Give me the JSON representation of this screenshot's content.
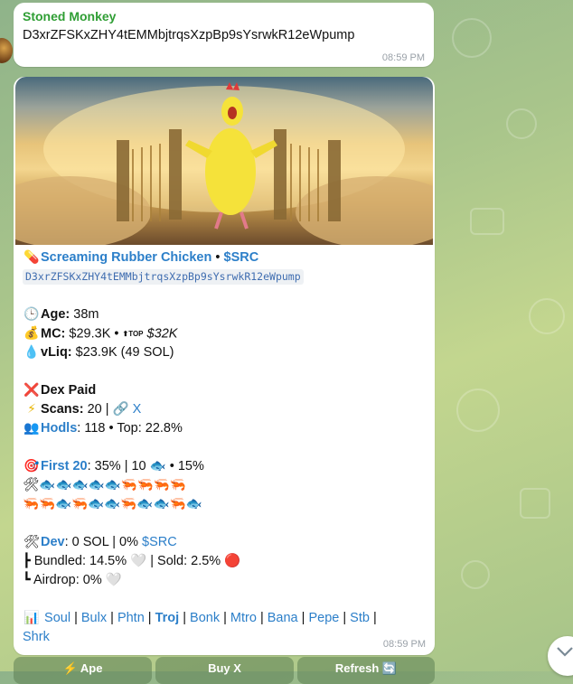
{
  "message1": {
    "sender": "Stoned Monkey",
    "text": "D3xrZFSKxZHY4tEMMbjtrqsXzpBp9sYsrwkR12eWpump",
    "time": "08:59 PM"
  },
  "message2": {
    "title_name": "Screaming Rubber Chicken",
    "title_sep": " • ",
    "ticker": "$SRC",
    "contract": "D3xrZFSKxZHY4tEMMbjtrqsXzpBp9sYsrwkR12eWpump",
    "age_label": "Age:",
    "age_value": " 38m",
    "mc_label": "MC:",
    "mc_value": " $29.3K  • ",
    "top_badge": "TOP",
    "mc_top": " $32K",
    "vliq_label": "vLiq:",
    "vliq_value": " $23.9K (49 SOL)",
    "dex_paid": "Dex Paid",
    "scans_label": "Scans:",
    "scans_value": " 20 | ",
    "scans_link": "X",
    "hodls_link": "Hodls",
    "hodls_value": ": 118 • Top: 22.8%",
    "first20_link": "First 20",
    "first20_value": ": 35% | 10 ",
    "first20_tail": " • 15%",
    "dev_link": "Dev",
    "dev_value": ": 0 SOL | 0% ",
    "dev_ticker": "$SRC",
    "bundled_text": "┣ Bundled: 14.5% ",
    "sold_text": " | Sold: 2.5% ",
    "airdrop_text": "┗ Airdrop: 0% ",
    "links": [
      "Soul",
      "Bulx",
      "Phtn",
      "Troj",
      "Bonk",
      "Mtro",
      "Bana",
      "Pepe",
      "Stb",
      "Shrk"
    ],
    "time": "08:59 PM"
  },
  "buttons": [
    "⚡ Ape",
    "Buy X",
    "Refresh 🔄"
  ],
  "colors": {
    "link": "#2c7fc9",
    "sender": "#2f9e34"
  }
}
